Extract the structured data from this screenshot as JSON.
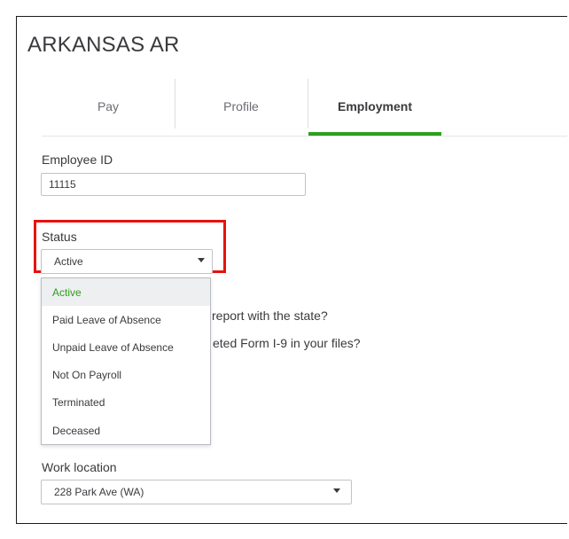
{
  "page": {
    "title": "ARKANSAS AR"
  },
  "tabs": [
    {
      "label": "Pay"
    },
    {
      "label": "Profile"
    },
    {
      "label": "Employment"
    }
  ],
  "employee_id": {
    "label": "Employee ID",
    "value": "11115"
  },
  "status": {
    "label": "Status",
    "selected": "Active",
    "options": [
      "Active",
      "Paid Leave of Absence",
      "Unpaid Leave of Absence",
      "Not On Payroll",
      "Terminated",
      "Deceased"
    ]
  },
  "questions": [
    {
      "visible_text": "report with the state?"
    },
    {
      "visible_text": "eted Form I-9 in your files?"
    }
  ],
  "work_location": {
    "label": "Work location",
    "selected": "228 Park Ave (WA)"
  },
  "colors": {
    "accent": "#2ca01c",
    "highlight": "#e8120c"
  }
}
